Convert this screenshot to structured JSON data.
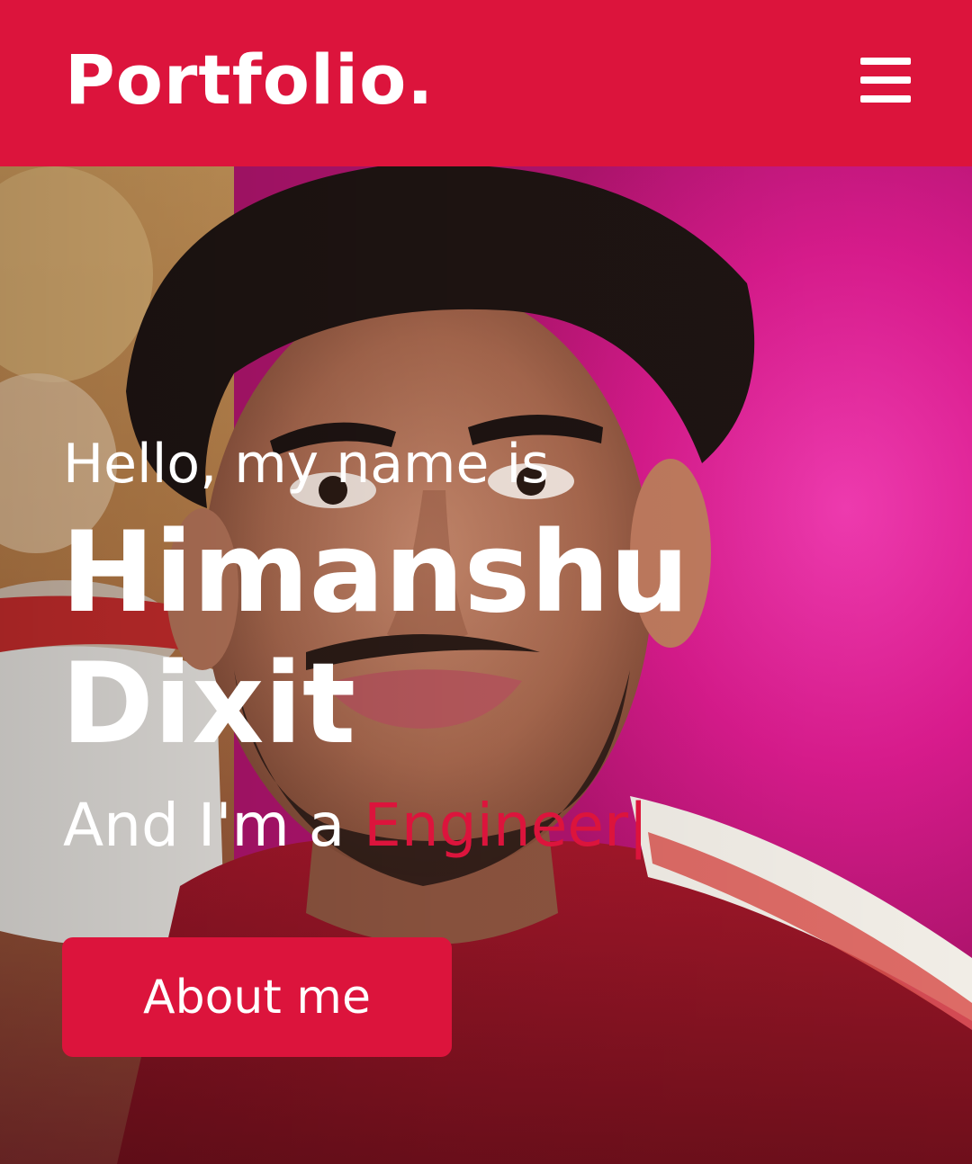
{
  "header": {
    "logo_text": "Portfolio.",
    "menu_icon": "hamburger-menu-icon"
  },
  "hero": {
    "greeting": "Hello, my name is",
    "name_first": "Himanshu",
    "name_last": "Dixit",
    "role_prefix": "And I'm a ",
    "role_typed": "Engineer",
    "role_cursor": "|",
    "button_label": "About me",
    "background_image": "portrait photo"
  },
  "colors": {
    "accent": "#dc143c",
    "text_on_accent": "#ffffff"
  }
}
